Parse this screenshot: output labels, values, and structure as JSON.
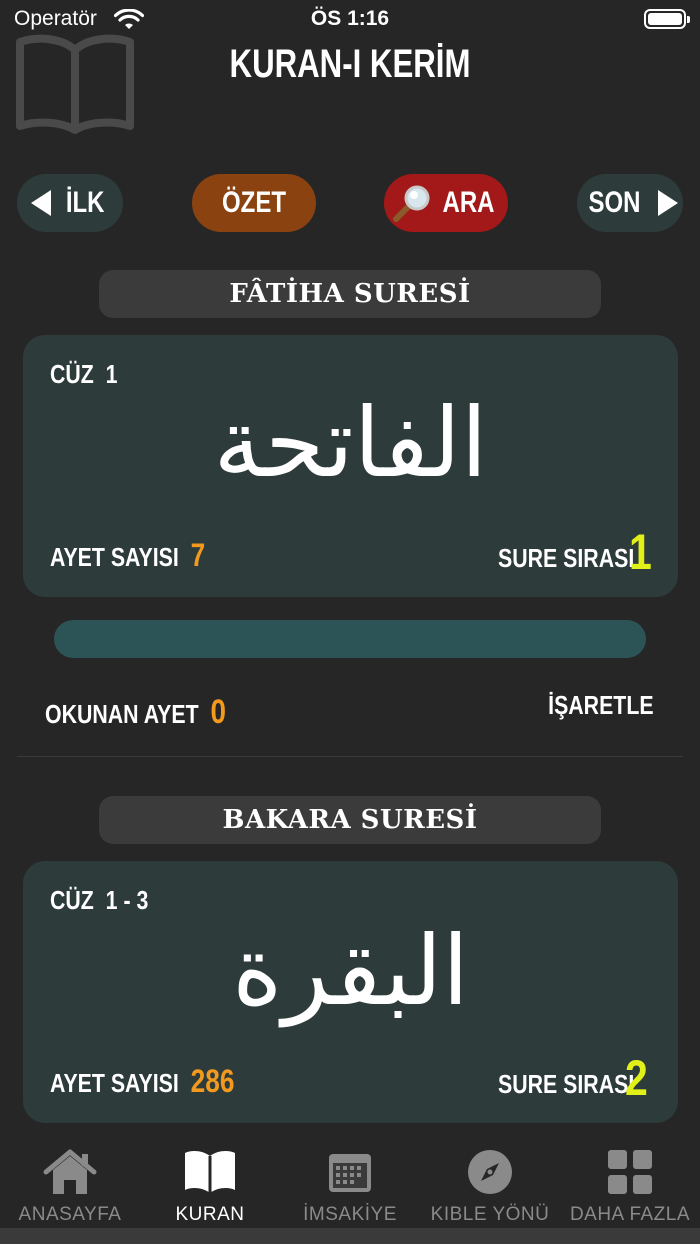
{
  "status_bar": {
    "carrier": "Operatör",
    "time": "ÖS 1:16"
  },
  "header": {
    "title": "KURAN-I KERİM"
  },
  "nav": {
    "first": "İLK",
    "summary": "ÖZET",
    "search": "ARA",
    "last": "SON"
  },
  "surahs": [
    {
      "name": "FÂTİHA SURESİ",
      "juz_label": "CÜZ",
      "juz": "1",
      "arabic": "الفاتحة",
      "verse_count_label": "AYET SAYISI",
      "verse_count": "7",
      "order_label": "SURE SIRASI",
      "order": "1"
    },
    {
      "name": "BAKARA SURESİ",
      "juz_label": "CÜZ",
      "juz": "1 - 3",
      "arabic": "البقرة",
      "verse_count_label": "AYET SAYISI",
      "verse_count": "286",
      "order_label": "SURE SIRASI",
      "order": "2"
    }
  ],
  "reading": {
    "label": "OKUNAN AYET",
    "count": "0",
    "progress": 0,
    "mark": "İŞARETLE"
  },
  "tab_bar": [
    {
      "label": "ANASAYFA",
      "icon": "home-icon",
      "active": false
    },
    {
      "label": "KURAN",
      "icon": "book-icon",
      "active": true
    },
    {
      "label": "İMSAKİYE",
      "icon": "calendar-icon",
      "active": false
    },
    {
      "label": "KIBLE YÖNÜ",
      "icon": "compass-icon",
      "active": false
    },
    {
      "label": "DAHA FAZLA",
      "icon": "grid-icon",
      "active": false
    }
  ],
  "colors": {
    "background": "#262626",
    "card": "#2e3b3b",
    "summary": "#8a4310",
    "search": "#a31818",
    "orange": "#f39a1e",
    "yellow": "#e2f01a",
    "progress_track": "#2c5457"
  }
}
